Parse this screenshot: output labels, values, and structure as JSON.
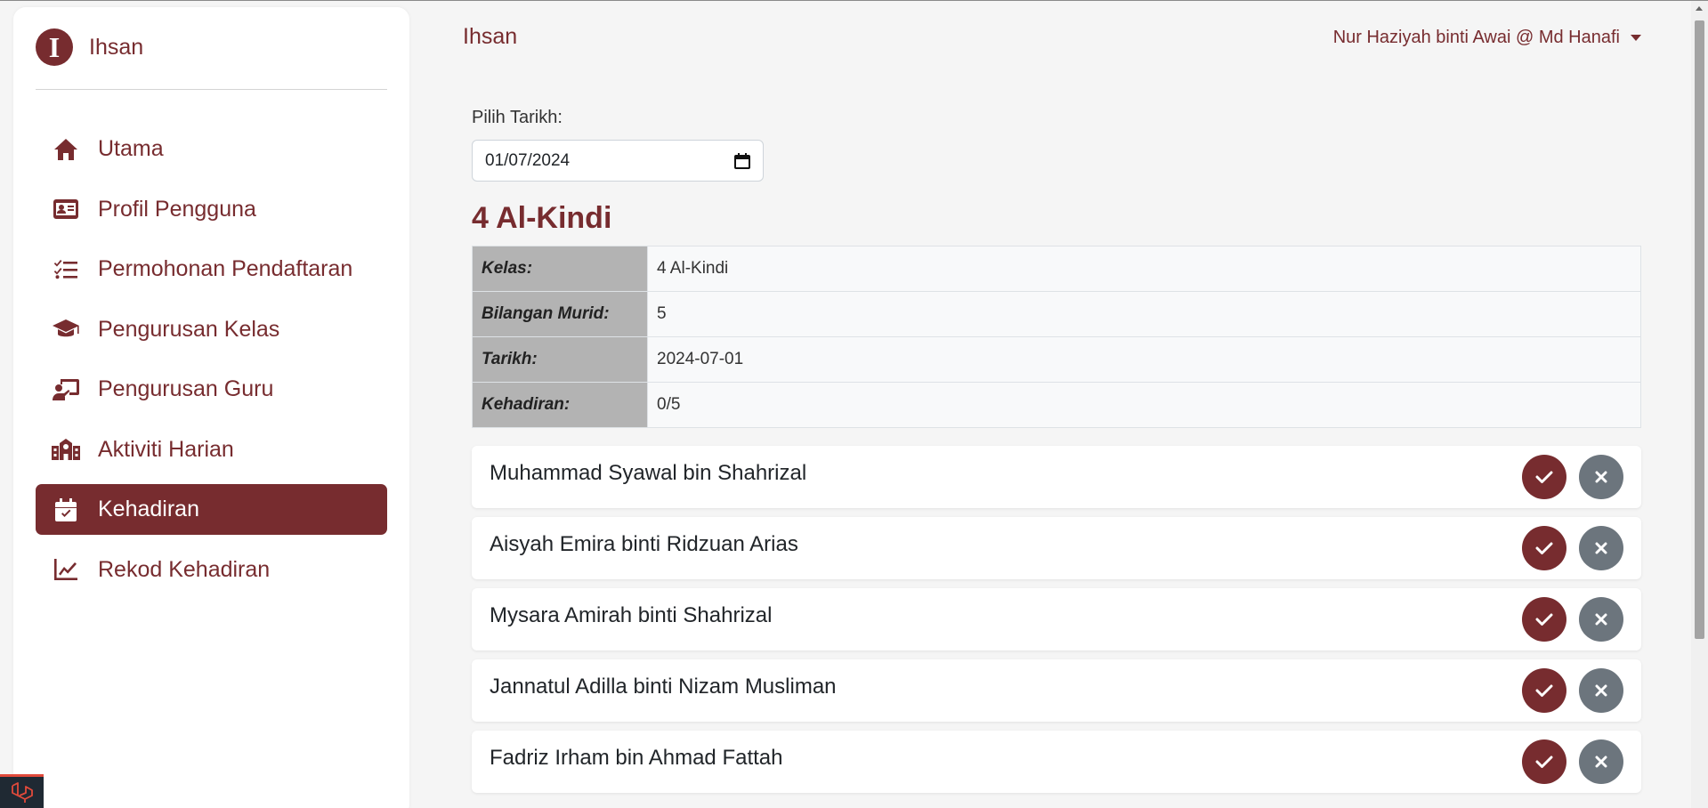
{
  "brand": {
    "logo_letter": "I",
    "name": "Ihsan"
  },
  "topbar": {
    "title": "Ihsan",
    "user_name": "Nur Haziyah binti Awai @ Md Hanafi"
  },
  "sidebar": {
    "items": [
      {
        "label": "Utama",
        "icon": "home-icon"
      },
      {
        "label": "Profil Pengguna",
        "icon": "id-card-icon"
      },
      {
        "label": "Permohonan Pendaftaran",
        "icon": "list-check-icon"
      },
      {
        "label": "Pengurusan Kelas",
        "icon": "graduation-cap-icon"
      },
      {
        "label": "Pengurusan Guru",
        "icon": "teacher-icon"
      },
      {
        "label": "Aktiviti Harian",
        "icon": "school-icon"
      },
      {
        "label": "Kehadiran",
        "icon": "calendar-check-icon",
        "active": true
      },
      {
        "label": "Rekod Kehadiran",
        "icon": "chart-line-icon"
      }
    ]
  },
  "date_picker": {
    "label": "Pilih Tarikh:",
    "value": "01/07/2024"
  },
  "class_info": {
    "title": "4 Al-Kindi",
    "rows": [
      {
        "key": "Kelas:",
        "value": "4 Al-Kindi"
      },
      {
        "key": "Bilangan Murid:",
        "value": "5"
      },
      {
        "key": "Tarikh:",
        "value": "2024-07-01"
      },
      {
        "key": "Kehadiran:",
        "value": "0/5"
      }
    ]
  },
  "students": [
    {
      "name": "Muhammad Syawal bin Shahrizal"
    },
    {
      "name": "Aisyah Emira binti Ridzuan Arias"
    },
    {
      "name": "Mysara Amirah binti Shahrizal"
    },
    {
      "name": "Jannatul Adilla binti Nizam Musliman"
    },
    {
      "name": "Fadriz Irham bin Ahmad Fattah"
    }
  ],
  "colors": {
    "primary": "#772c2f",
    "secondary": "#6c757d",
    "background": "#f5f5f5"
  }
}
